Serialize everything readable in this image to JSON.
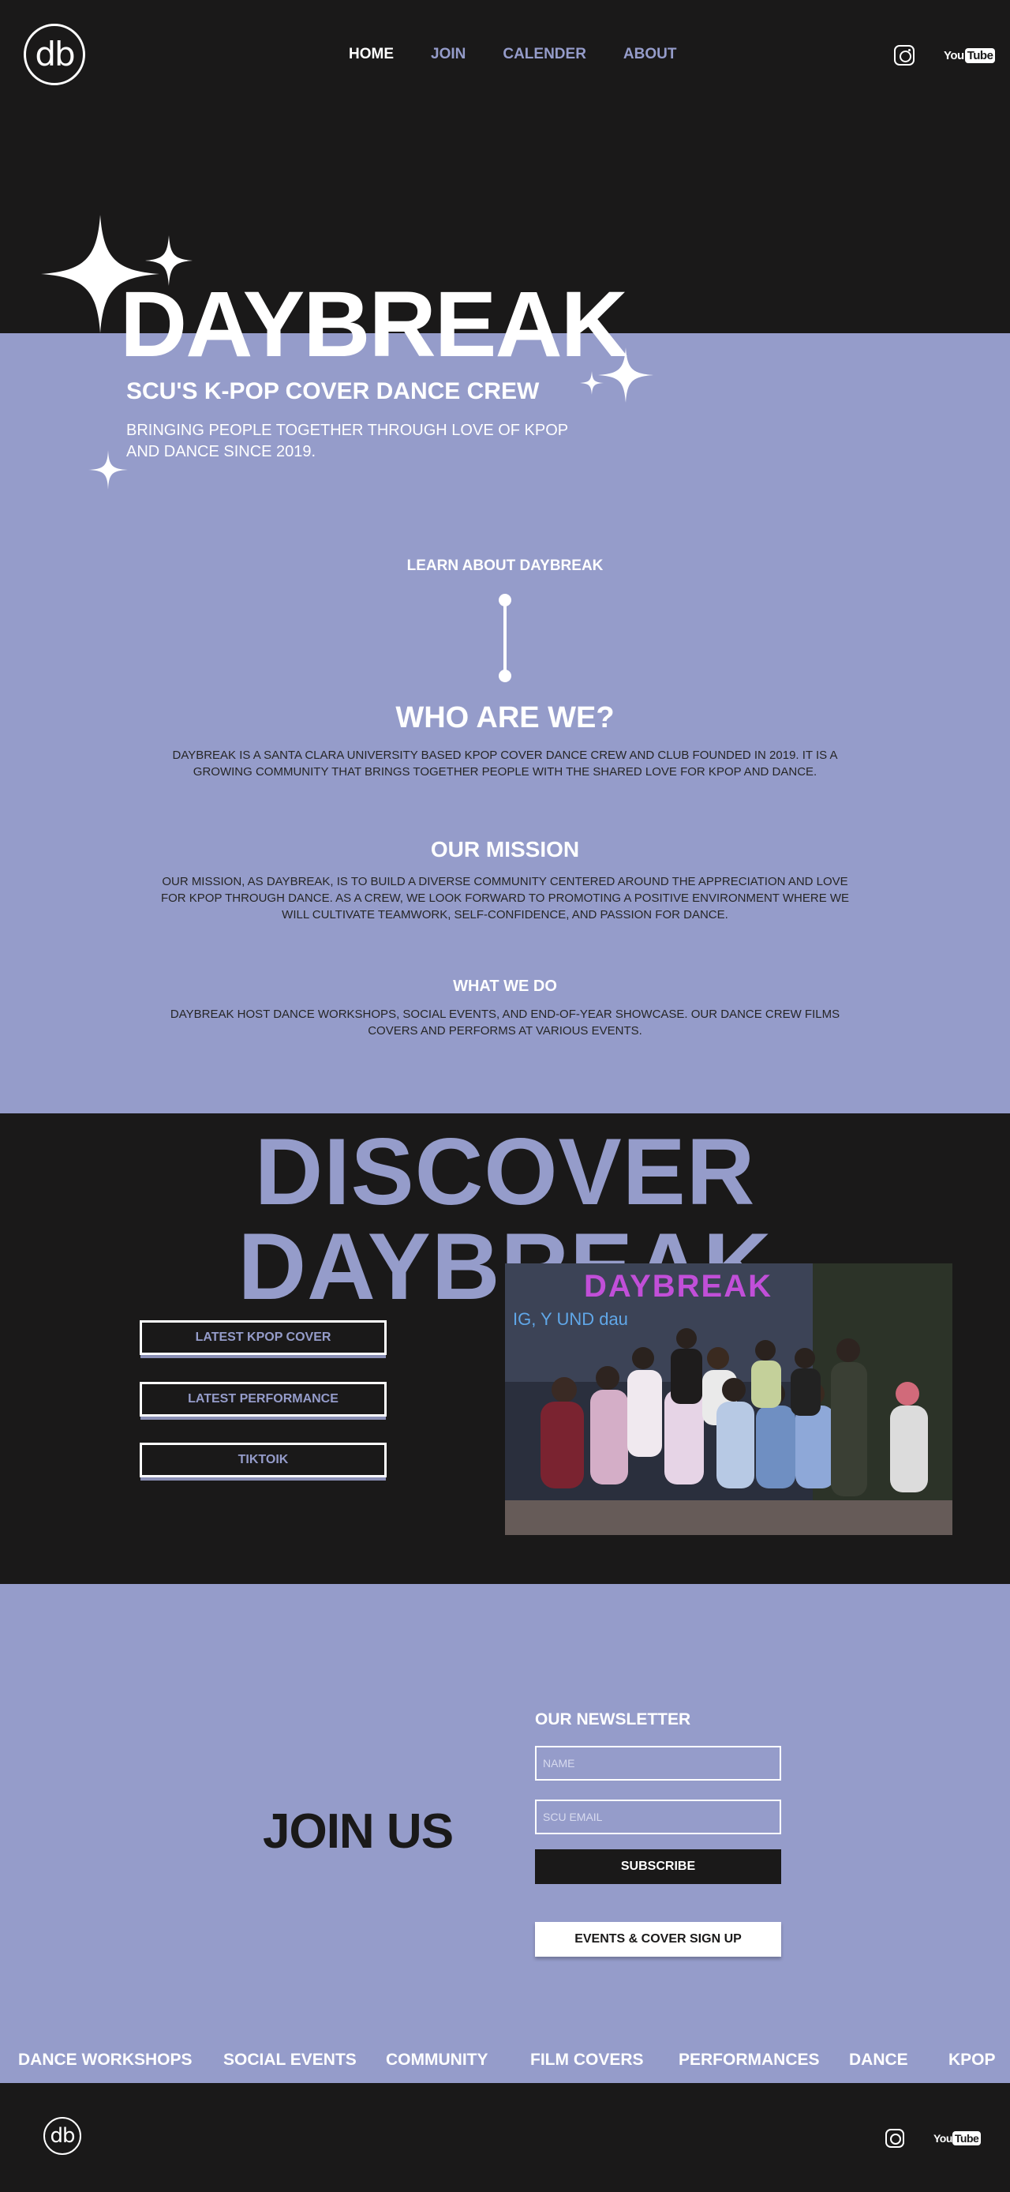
{
  "header": {
    "logo_text": "db",
    "nav": [
      {
        "label": "HOME",
        "active": true
      },
      {
        "label": "JOIN",
        "active": false
      },
      {
        "label": "CALENDER",
        "active": false
      },
      {
        "label": "ABOUT",
        "active": false
      }
    ],
    "social": {
      "youtube_you": "You",
      "youtube_tube": "Tube"
    }
  },
  "hero": {
    "title": "DAYBREAK",
    "subtitle": "SCU'S K-POP COVER DANCE CREW",
    "description": "BRINGING PEOPLE TOGETHER THROUGH LOVE OF KPOP AND DANCE SINCE 2019."
  },
  "about": {
    "learn_label": "LEARN ABOUT DAYBREAK",
    "who_title": "WHO ARE WE?",
    "who_body": "DAYBREAK IS A SANTA CLARA UNIVERSITY BASED KPOP COVER DANCE CREW AND CLUB FOUNDED IN 2019. IT IS A GROWING COMMUNITY THAT BRINGS TOGETHER PEOPLE WITH THE SHARED LOVE FOR KPOP AND DANCE.",
    "mission_title": "OUR MISSION",
    "mission_body": "OUR MISSION, AS DAYBREAK, IS TO BUILD A DIVERSE COMMUNITY CENTERED AROUND THE APPRECIATION AND LOVE FOR KPOP THROUGH DANCE. AS A CREW, WE LOOK FORWARD TO PROMOTING A POSITIVE ENVIRONMENT WHERE WE WILL CULTIVATE TEAMWORK, SELF-CONFIDENCE, AND PASSION FOR DANCE.",
    "whatwedo_title": "WHAT WE DO",
    "whatwedo_body": "DAYBREAK HOST DANCE WORKSHOPS, SOCIAL EVENTS, AND END-OF-YEAR SHOWCASE. OUR DANCE CREW FILMS COVERS AND PERFORMS AT VARIOUS EVENTS."
  },
  "discover": {
    "title": "DISCOVER DAYBREAK",
    "buttons": [
      "LATEST KPOP COVER",
      "LATEST PERFORMANCE",
      "TIKTOIK"
    ],
    "photo_banner_text": "DAYBREAK",
    "photo_banner_sub": "IG, Y     UND     dau"
  },
  "marquee": [
    "DANCE WORKSHOPS",
    "SOCIAL EVENTS",
    "COMMUNITY",
    "FILM COVERS",
    "PERFORMANCES",
    "DANCE",
    "KPOP"
  ],
  "join": {
    "title": "JOIN US",
    "newsletter_title": "OUR NEWSLETTER",
    "name_placeholder": "NAME",
    "email_placeholder": "SCU EMAIL",
    "subscribe_label": "SUBSCRIBE",
    "signup_label": "EVENTS & COVER SIGN UP"
  },
  "footer": {
    "logo_text": "db",
    "youtube_you": "You",
    "youtube_tube": "Tube"
  },
  "colors": {
    "dark": "#1a1919",
    "lavender": "#959cca",
    "white": "#ffffff"
  }
}
